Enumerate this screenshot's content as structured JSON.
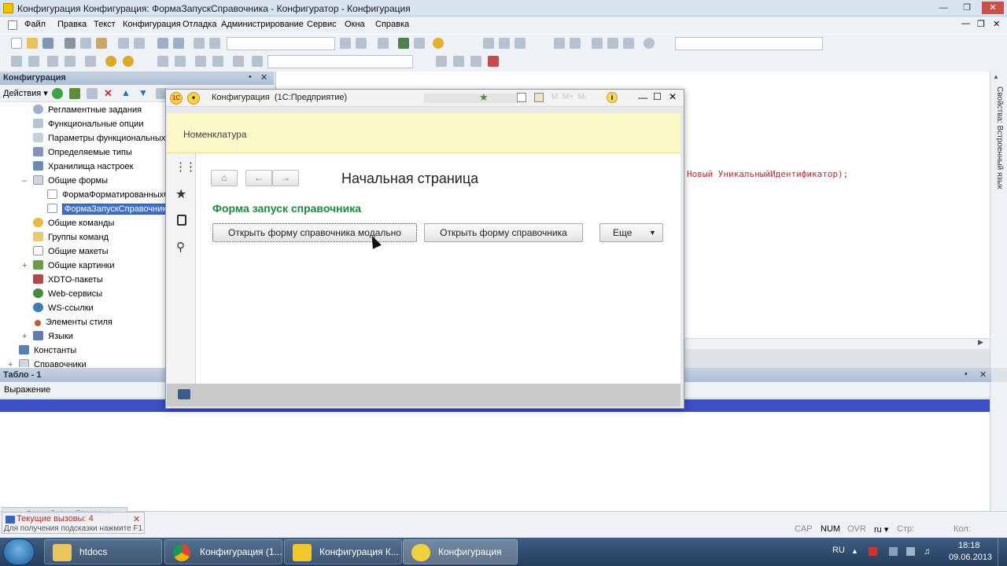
{
  "titlebar": {
    "title": "Конфигурация Конфигурация: ФормаЗапускСправочника - Конфигуратор - Конфигурация"
  },
  "menu": [
    "Файл",
    "Правка",
    "Текст",
    "Конфигурация",
    "Отладка",
    "Администрирование",
    "Сервис",
    "Окна",
    "Справка"
  ],
  "config_panel": {
    "title": "Конфигурация",
    "actions_label": "Действия",
    "items": [
      {
        "label": "Регламентные задания",
        "indent": 1
      },
      {
        "label": "Функциональные опции",
        "indent": 1
      },
      {
        "label": "Параметры функциональных оп",
        "indent": 1
      },
      {
        "label": "Определяемые типы",
        "indent": 1
      },
      {
        "label": "Хранилища настроек",
        "indent": 1
      },
      {
        "label": "Общие формы",
        "indent": 1
      },
      {
        "label": "ФормаФорматированныхС",
        "indent": 2
      },
      {
        "label": "ФормаЗапускСправочника",
        "indent": 2
      },
      {
        "label": "Общие команды",
        "indent": 1
      },
      {
        "label": "Группы команд",
        "indent": 1
      },
      {
        "label": "Общие макеты",
        "indent": 1
      },
      {
        "label": "Общие картинки",
        "indent": 1
      },
      {
        "label": "XDTO-пакеты",
        "indent": 1
      },
      {
        "label": "Web-сервисы",
        "indent": 1
      },
      {
        "label": "WS-ссылки",
        "indent": 1
      },
      {
        "label": "Элементы стиля",
        "indent": 1
      },
      {
        "label": "Языки",
        "indent": 1
      },
      {
        "label": "Константы",
        "indent": 0
      },
      {
        "label": "Справочники",
        "indent": 0
      }
    ]
  },
  "editor": {
    "code_line": "Новый УникальныйИдентификатор);"
  },
  "right_panel": {
    "label": "Свойства: Встроенный язык"
  },
  "tablo": {
    "title": "Табло - 1",
    "column": "Выражение"
  },
  "status": {
    "calls_tab": "ФормаЗапускСправочн",
    "calls_label": "Текущие вызовы: 4",
    "hint": "Для получения подсказки нажмите F1",
    "cap": "CAP",
    "num": "NUM",
    "ovr": "OVR",
    "lang": "ru",
    "line_label": "Стр:",
    "col_label": "Кол:"
  },
  "enterprise": {
    "title": "Конфигурация  (1С:Предприятие)",
    "section": "Номенклатура",
    "home_title": "Начальная страница",
    "form_title": "Форма запуск справочника",
    "btn_modal": "Открыть форму справочника модально",
    "btn_open": "Открыть форму справочника",
    "btn_more": "Еще",
    "title_color": "#1a8d3a"
  },
  "taskbar": {
    "items": [
      {
        "label": "htdocs"
      },
      {
        "label": "Конфигурация (1..."
      },
      {
        "label": "Конфигурация К..."
      },
      {
        "label": "Конфигурация"
      }
    ],
    "lang": "RU",
    "time": "18:18",
    "date": "09.06.2013"
  }
}
